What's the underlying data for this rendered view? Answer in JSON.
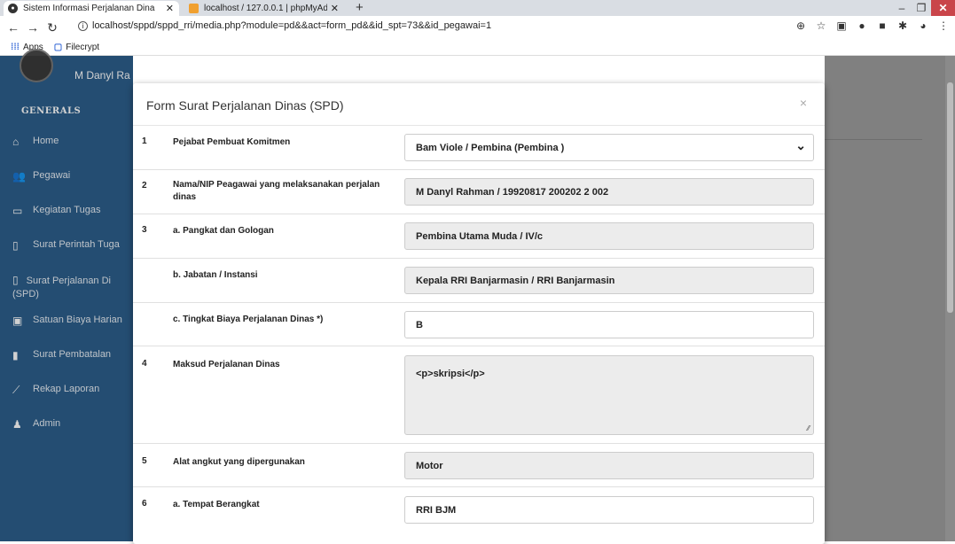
{
  "browser": {
    "tabs": [
      {
        "title": "Sistem Informasi Perjalanan Dina"
      },
      {
        "title": "localhost / 127.0.0.1 | phpMyAdr"
      }
    ],
    "url": "localhost/sppd/sppd_rri/media.php?module=pd&&act=form_pd&&id_spt=73&&id_pegawai=1",
    "bookmarks": [
      {
        "label": "Apps"
      },
      {
        "label": "Filecrypt"
      }
    ]
  },
  "sidebar": {
    "user_name": "M Danyl Ra",
    "brand": "GENERALS",
    "items": [
      {
        "label": "Home",
        "icon": "home-icon"
      },
      {
        "label": "Pegawai",
        "icon": "users-icon"
      },
      {
        "label": "Kegiatan Tugas",
        "icon": "keyboard-icon"
      },
      {
        "label": "Surat Perintah Tuga",
        "icon": "pdf-icon"
      },
      {
        "label": "Surat Perjalanan Di",
        "label2": "(SPD)",
        "icon": "pdf-icon"
      },
      {
        "label": "Satuan Biaya Harian",
        "icon": "money-icon"
      },
      {
        "label": "Surat Pembatalan",
        "icon": "file-icon"
      },
      {
        "label": "Rekap Laporan",
        "icon": "chart-icon"
      },
      {
        "label": "Admin",
        "icon": "user-icon"
      }
    ]
  },
  "modal": {
    "title": "Form Surat Perjalanan Dinas (SPD)",
    "close": "×",
    "rows": [
      {
        "num": "1",
        "label": "Pejabat Pembuat Komitmen",
        "value": "Bam Viole / Pembina (Pembina )"
      },
      {
        "num": "2",
        "label": "Nama/NIP Peagawai yang melaksanakan perjalan dinas",
        "value": "M Danyl Rahman / 19920817 200202 2 002"
      },
      {
        "num": "3",
        "label": "a. Pangkat dan Gologan",
        "value": "Pembina Utama Muda / IV/c"
      },
      {
        "num": "",
        "label": "b. Jabatan / Instansi",
        "value": "Kepala RRI Banjarmasin / RRI Banjarmasin"
      },
      {
        "num": "",
        "label": "c. Tingkat Biaya Perjalanan Dinas *)",
        "value": "B"
      },
      {
        "num": "4",
        "label": "Maksud Perjalanan Dinas",
        "value": "<p>skripsi</p>"
      },
      {
        "num": "5",
        "label": "Alat angkut yang dipergunakan",
        "value": "Motor"
      },
      {
        "num": "6",
        "label": "a. Tempat Berangkat",
        "value": "RRI BJM"
      }
    ]
  }
}
